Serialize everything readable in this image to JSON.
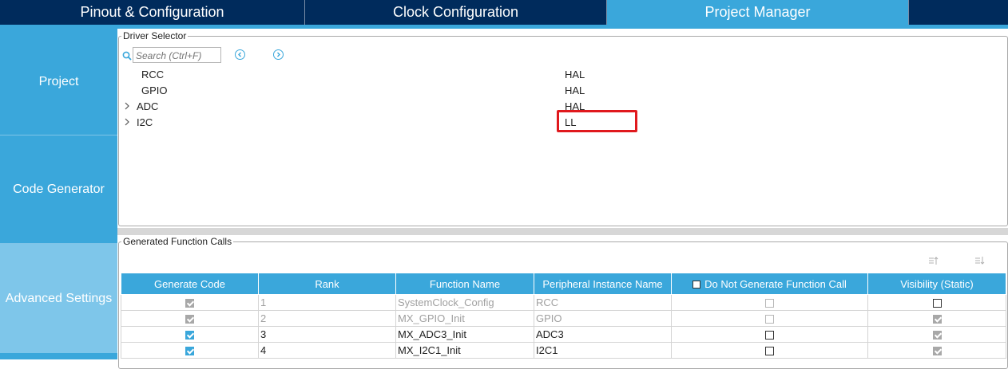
{
  "tabs": [
    {
      "label": "Pinout & Configuration"
    },
    {
      "label": "Clock Configuration"
    },
    {
      "label": "Project Manager"
    }
  ],
  "sidebar": {
    "items": [
      {
        "label": "Project"
      },
      {
        "label": "Code Generator"
      },
      {
        "label": "Advanced Settings"
      }
    ]
  },
  "driver_selector": {
    "legend": "Driver Selector",
    "search_placeholder": "Search (Ctrl+F)",
    "rows": [
      {
        "name": "RCC",
        "driver": "HAL"
      },
      {
        "name": "GPIO",
        "driver": "HAL"
      },
      {
        "name": "ADC",
        "driver": "HAL"
      },
      {
        "name": "I2C",
        "driver": "LL"
      }
    ]
  },
  "function_calls": {
    "legend": "Generated Function Calls",
    "headers": [
      "Generate Code",
      "Rank",
      "Function Name",
      "Peripheral Instance Name",
      "Do Not Generate Function Call",
      "Visibility (Static)"
    ],
    "rows": [
      {
        "rank": "1",
        "function": "SystemClock_Config",
        "instance": "RCC"
      },
      {
        "rank": "2",
        "function": "MX_GPIO_Init",
        "instance": "GPIO"
      },
      {
        "rank": "3",
        "function": "MX_ADC3_Init",
        "instance": "ADC3"
      },
      {
        "rank": "4",
        "function": "MX_I2C1_Init",
        "instance": "I2C1"
      }
    ]
  },
  "colors": {
    "navy": "#002b5c",
    "accent": "#3aa7db",
    "highlight": "#e0191d"
  }
}
